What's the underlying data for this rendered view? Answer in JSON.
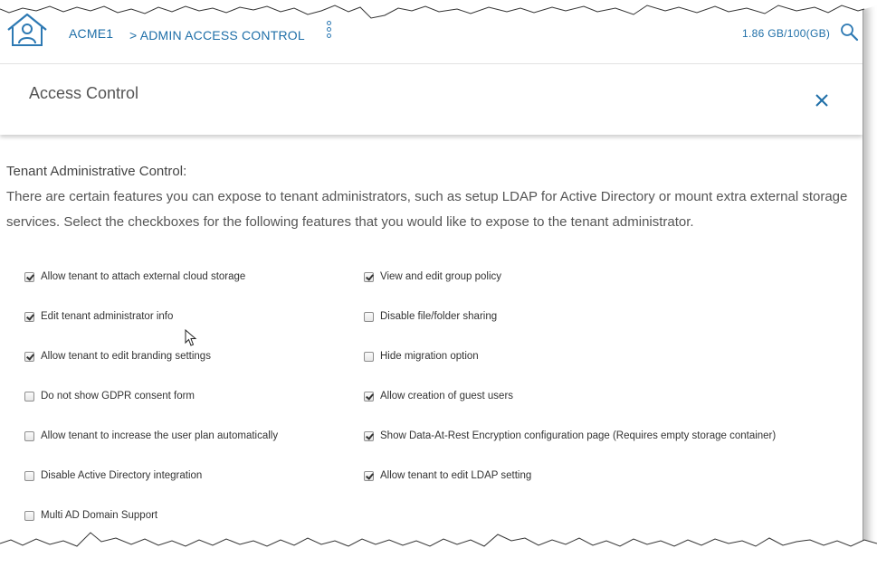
{
  "header": {
    "tenant_name": "ACME1",
    "breadcrumb_current": "> ADMIN ACCESS CONTROL",
    "storage_usage": "1.86 GB/100(GB)"
  },
  "panel": {
    "title": "Access Control"
  },
  "section": {
    "label": "Tenant Administrative Control:",
    "description": "There are certain features you can expose to tenant administrators, such as setup LDAP for Active Directory or mount extra external storage services. Select the checkboxes for the following features that you would like to expose to the tenant administrator."
  },
  "options_left": [
    {
      "label": "Allow tenant to attach external cloud storage",
      "checked": true
    },
    {
      "label": "Edit tenant administrator info",
      "checked": true
    },
    {
      "label": "Allow tenant to edit branding settings",
      "checked": true
    },
    {
      "label": "Do not show GDPR consent form",
      "checked": false
    },
    {
      "label": "Allow tenant to increase the user plan automatically",
      "checked": false
    },
    {
      "label": "Disable Active Directory integration",
      "checked": false
    },
    {
      "label": "Multi AD Domain Support",
      "checked": false
    }
  ],
  "options_right": [
    {
      "label": "View and edit group policy",
      "checked": true
    },
    {
      "label": "Disable file/folder sharing",
      "checked": false
    },
    {
      "label": "Hide migration option",
      "checked": false
    },
    {
      "label": "Allow creation of guest users",
      "checked": true
    },
    {
      "label": "Show Data-At-Rest Encryption configuration page (Requires empty storage container)",
      "checked": true
    },
    {
      "label": "Allow tenant to edit LDAP setting",
      "checked": true
    }
  ],
  "colors": {
    "accent": "#1f6fa8",
    "text": "#555555"
  }
}
